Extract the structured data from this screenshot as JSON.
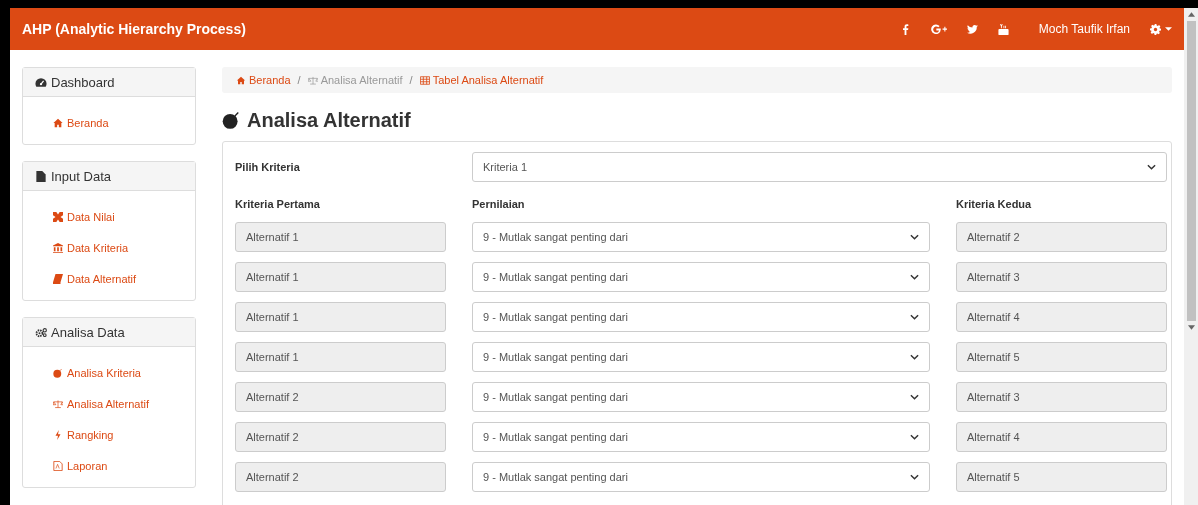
{
  "navbar": {
    "title": "AHP (Analytic Hierarchy Process)",
    "user_name": "Moch Taufik Irfan"
  },
  "sidebar": {
    "panels": [
      {
        "title": "Dashboard",
        "items": [
          {
            "label": "Beranda"
          }
        ]
      },
      {
        "title": "Input Data",
        "items": [
          {
            "label": "Data Nilai"
          },
          {
            "label": "Data Kriteria"
          },
          {
            "label": "Data Alternatif"
          }
        ]
      },
      {
        "title": "Analisa Data",
        "items": [
          {
            "label": "Analisa Kriteria"
          },
          {
            "label": "Analisa Alternatif"
          },
          {
            "label": "Rangking"
          },
          {
            "label": "Laporan"
          }
        ]
      }
    ]
  },
  "breadcrumb": [
    {
      "label": "Beranda",
      "kind": "link"
    },
    {
      "separator": "/",
      "label": "Analisa Alternatif",
      "kind": "text"
    },
    {
      "separator": "/",
      "label": "Tabel Analisa Alternatif",
      "kind": "link"
    }
  ],
  "page_title": "Analisa Alternatif",
  "form": {
    "select_label": "Pilih Kriteria",
    "select_value": "Kriteria 1",
    "headers": [
      "Kriteria Pertama",
      "Pernilaian",
      "Kriteria Kedua"
    ],
    "rows": [
      {
        "first": "Alternatif 1",
        "rating": "9 - Mutlak sangat penting dari",
        "second": "Alternatif 2"
      },
      {
        "first": "Alternatif 1",
        "rating": "9 - Mutlak sangat penting dari",
        "second": "Alternatif 3"
      },
      {
        "first": "Alternatif 1",
        "rating": "9 - Mutlak sangat penting dari",
        "second": "Alternatif 4"
      },
      {
        "first": "Alternatif 1",
        "rating": "9 - Mutlak sangat penting dari",
        "second": "Alternatif 5"
      },
      {
        "first": "Alternatif 2",
        "rating": "9 - Mutlak sangat penting dari",
        "second": "Alternatif 3"
      },
      {
        "first": "Alternatif 2",
        "rating": "9 - Mutlak sangat penting dari",
        "second": "Alternatif 4"
      },
      {
        "first": "Alternatif 2",
        "rating": "9 - Mutlak sangat penting dari",
        "second": "Alternatif 5"
      }
    ]
  }
}
